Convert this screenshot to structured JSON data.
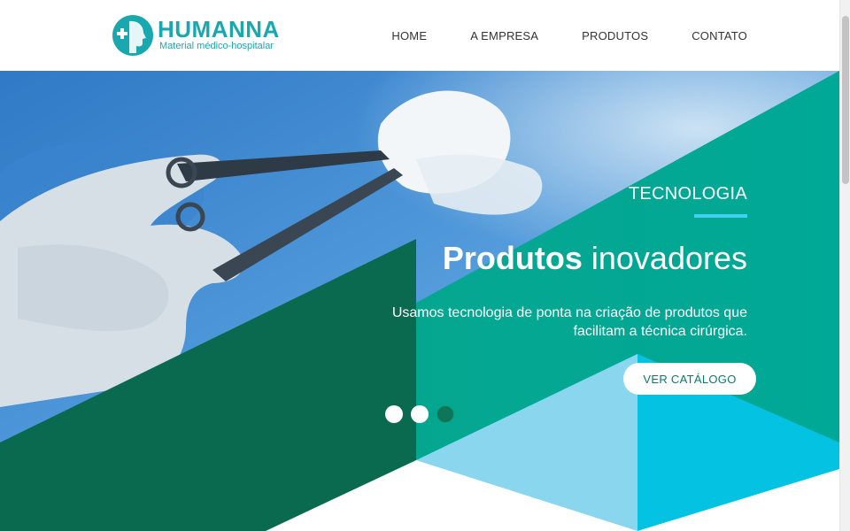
{
  "brand": {
    "name": "HUMANNA",
    "tagline": "Material médico-hospitalar",
    "logo_icon": "profile-head-cross-icon",
    "color": "#19a7b0"
  },
  "nav": {
    "items": [
      {
        "label": "HOME"
      },
      {
        "label": "A EMPRESA"
      },
      {
        "label": "PRODUTOS"
      },
      {
        "label": "CONTATO"
      }
    ]
  },
  "hero": {
    "kicker": "TECNOLOGIA",
    "headline_bold": "Produtos",
    "headline_light": "inovadores",
    "lead": "Usamos tecnologia de ponta na criação de produtos que facilitam a técnica cirúrgica.",
    "cta_label": "VER CATÁLOGO",
    "slides_total": 3,
    "active_slide": 3,
    "photo_subject": "surgical-hands-scissors-image",
    "colors": {
      "teal": "#00a58e",
      "dark_green": "#0a6a4f",
      "cyan": "#04c2e2",
      "light_blue": "#8ad6ee",
      "accent_line": "#3fd0f0"
    }
  }
}
